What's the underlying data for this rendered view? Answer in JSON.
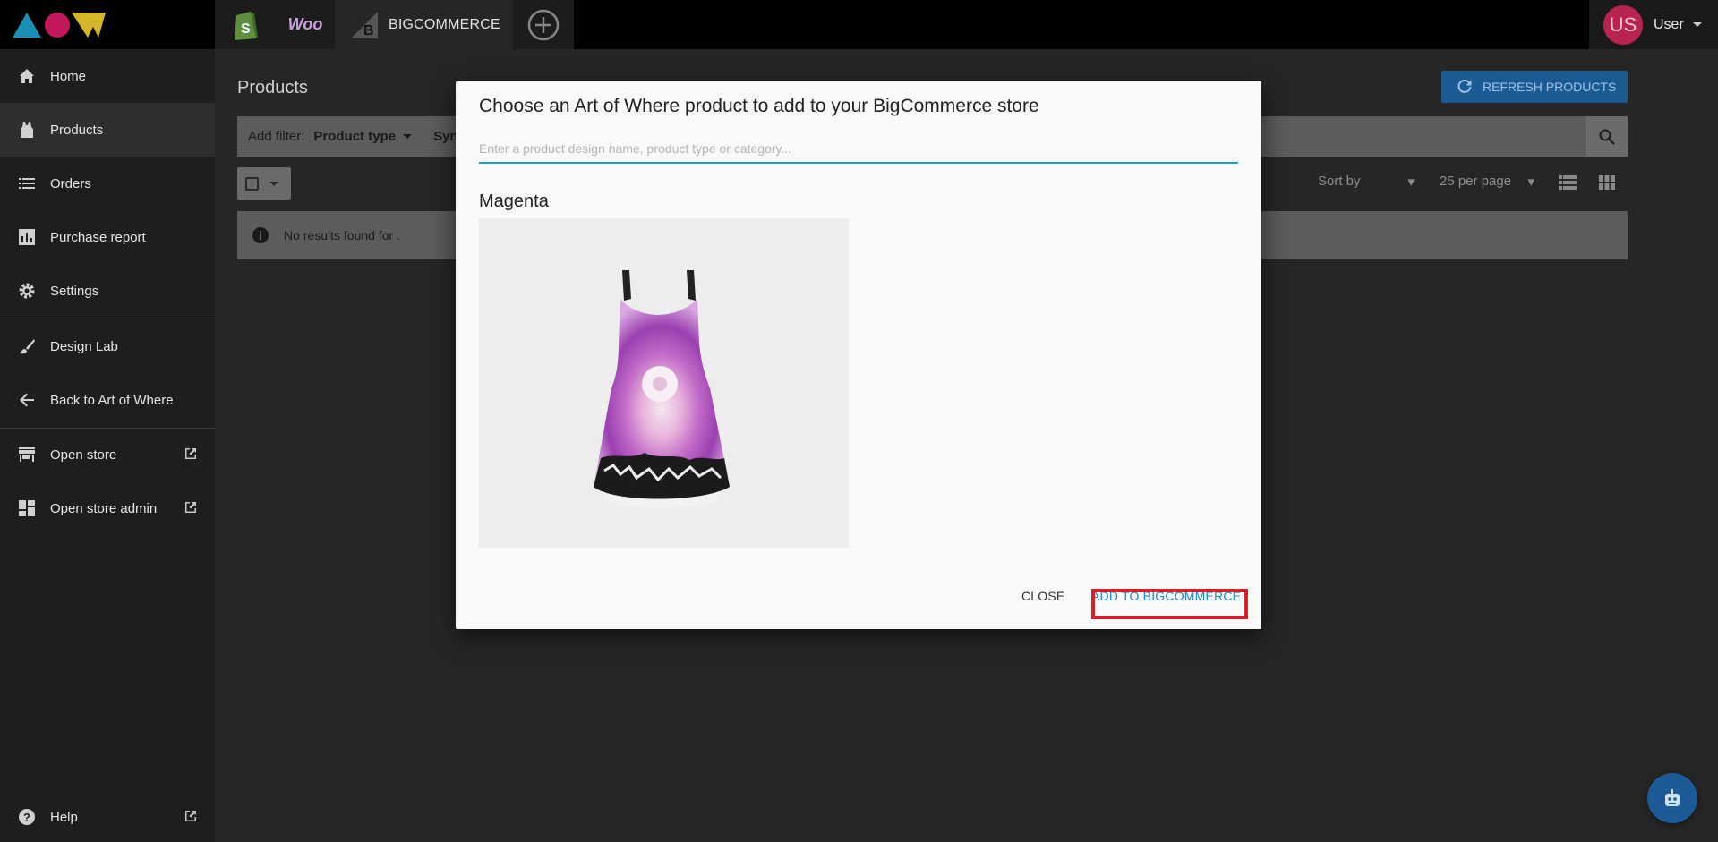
{
  "topbar": {
    "logo_alt": "AOW",
    "platforms": {
      "shopify": "shopify-icon",
      "woo": "Woo",
      "bigcommerce": "BIGCOMMERCE",
      "add": "add-platform-icon"
    },
    "user": {
      "initials": "US",
      "name": "User"
    }
  },
  "sidebar": {
    "items": [
      {
        "label": "Home",
        "icon": "home-icon"
      },
      {
        "label": "Products",
        "icon": "tank-top-icon",
        "active": true
      },
      {
        "label": "Orders",
        "icon": "list-icon"
      },
      {
        "label": "Purchase report",
        "icon": "bar-chart-icon"
      },
      {
        "label": "Settings",
        "icon": "gear-icon"
      },
      {
        "label": "Design Lab",
        "icon": "brush-icon"
      },
      {
        "label": "Back to Art of Where",
        "icon": "arrow-left-icon"
      },
      {
        "label": "Open store",
        "icon": "store-icon"
      },
      {
        "label": "Open store admin",
        "icon": "dashboard-icon"
      },
      {
        "label": "Help",
        "icon": "help-icon"
      }
    ]
  },
  "main": {
    "title": "Products",
    "refresh_label": "REFRESH PRODUCTS",
    "filter": {
      "add_filter_label": "Add filter:",
      "product_type_label": "Product type",
      "sync_label": "Sync"
    },
    "sort_by": "Sort by",
    "per_page": "25 per page",
    "notice": "No results found for ."
  },
  "modal": {
    "title": "Choose an Art of Where product to add to your BigCommerce store",
    "search_placeholder": "Enter a product design name, product type or category...",
    "group_name": "Magenta",
    "close_label": "CLOSE",
    "add_label": "ADD TO BIGCOMMERCE"
  },
  "colors": {
    "accent": "#1e9fd4",
    "highlight": "#d8202a",
    "avatar": "#b8234f"
  }
}
